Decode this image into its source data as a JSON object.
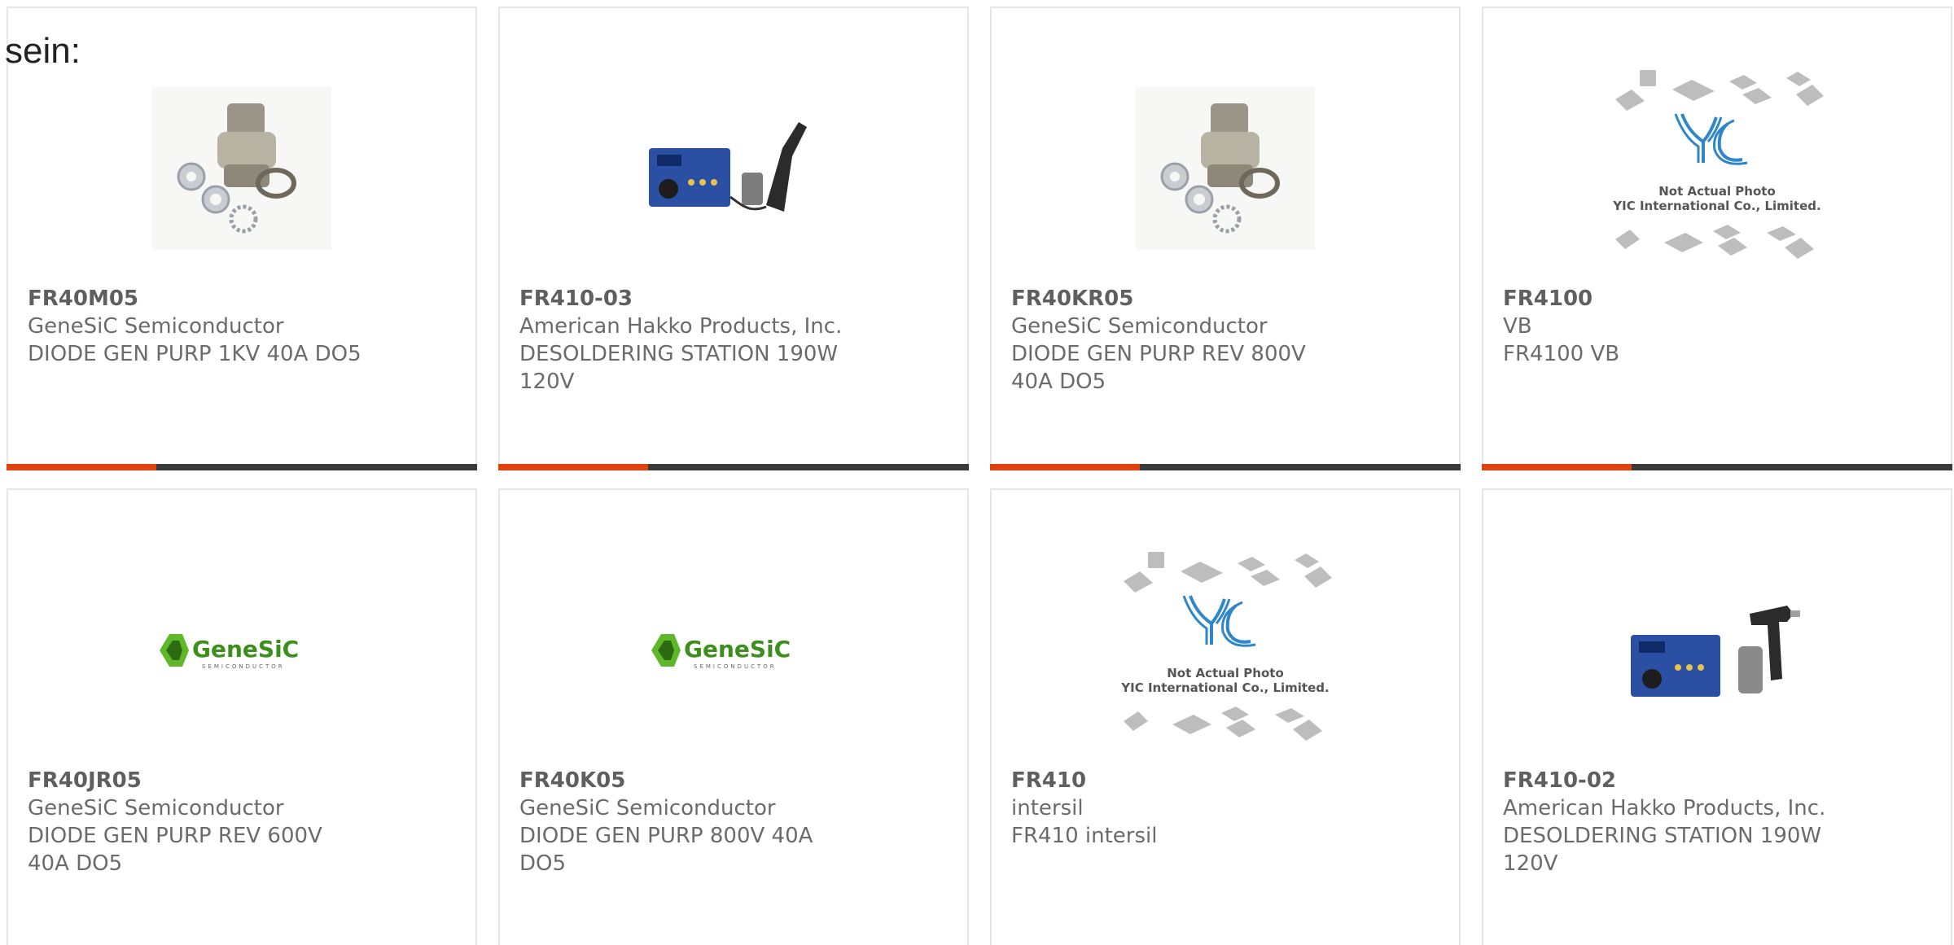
{
  "overlay_text": "sein:",
  "colors": {
    "accent": "#e0420f",
    "bar_dark": "#3a3a3a",
    "text": "#6b6b6b",
    "border": "#e6e6e6"
  },
  "cards": [
    {
      "part": "FR40M05",
      "mfr": "GeneSiC Semiconductor",
      "desc": "DIODE GEN PURP 1KV 40A DO5",
      "image": "diode-stud"
    },
    {
      "part": "FR410-03",
      "mfr": "American Hakko Products, Inc.",
      "desc": "DESOLDERING STATION 190W 120V",
      "image": "desoldering-station"
    },
    {
      "part": "FR40KR05",
      "mfr": "GeneSiC Semiconductor",
      "desc": "DIODE GEN PURP REV 800V 40A DO5",
      "image": "diode-stud"
    },
    {
      "part": "FR4100",
      "mfr": "VB",
      "desc": "FR4100 VB",
      "image": "yic-placeholder",
      "image_text": {
        "line1": "Not Actual Photo",
        "line2": "YIC International Co., Limited."
      }
    },
    {
      "part": "FR40JR05",
      "mfr": "GeneSiC Semiconductor",
      "desc": "DIODE GEN PURP REV 600V 40A DO5",
      "image": "genesic-logo",
      "image_text": {
        "logo": "GeneSiC",
        "sub": "SEMICONDUCTOR"
      }
    },
    {
      "part": "FR40K05",
      "mfr": "GeneSiC Semiconductor",
      "desc": "DIODE GEN PURP 800V 40A DO5",
      "image": "genesic-logo",
      "image_text": {
        "logo": "GeneSiC",
        "sub": "SEMICONDUCTOR"
      }
    },
    {
      "part": "FR410",
      "mfr": "intersil",
      "desc": "FR410 intersil",
      "image": "yic-placeholder",
      "image_text": {
        "line1": "Not Actual Photo",
        "line2": "YIC International Co., Limited."
      }
    },
    {
      "part": "FR410-02",
      "mfr": "American Hakko Products, Inc.",
      "desc": "DESOLDERING STATION 190W 120V",
      "image": "desoldering-station-gun"
    }
  ]
}
